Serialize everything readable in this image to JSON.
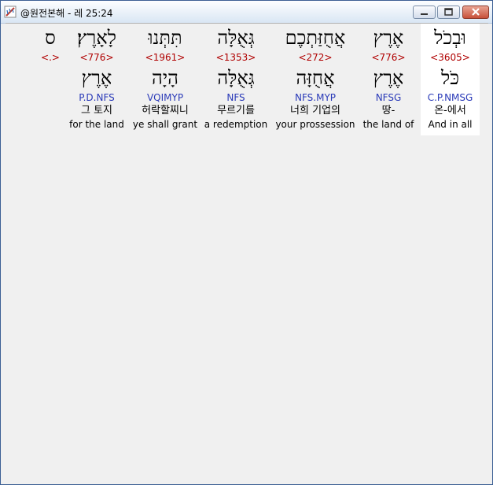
{
  "window": {
    "title": "@원전본해 - 레 25:24",
    "icons": {
      "app": "app-feather-icon",
      "minimize": "minimize-icon",
      "maximize": "maximize-icon",
      "close": "close-icon"
    }
  },
  "words": [
    {
      "heb": "וּבְכֹל",
      "strong": "<3605>",
      "lemma": "כֹּל",
      "parse": "C.P.NMSG",
      "kor": "온-에서",
      "eng": "And in all",
      "selected": true
    },
    {
      "heb": "אֶרֶץ",
      "strong": "<776>",
      "lemma": "אֶרֶץ",
      "parse": "NFSG",
      "kor": "땅-",
      "eng": "the land of",
      "selected": false
    },
    {
      "heb": "אֲחֻזַּתְכֶם",
      "strong": "<272>",
      "lemma": "אֲחֻזָּה",
      "parse": "NFS.MYP",
      "kor": "너희 기업의",
      "eng": "your prossession",
      "selected": false
    },
    {
      "heb": "גְּאֻלָּה",
      "strong": "<1353>",
      "lemma": "גְּאֻלָּה",
      "parse": "NFS",
      "kor": "무르기를",
      "eng": "a redemption",
      "selected": false
    },
    {
      "heb": "תִּתְּנוּ",
      "strong": "<1961>",
      "lemma": "הָיָה",
      "parse": "VQIMYP",
      "kor": "허락할찌니",
      "eng": "ye shall grant",
      "selected": false
    },
    {
      "heb": "לָאָרֶץ׃",
      "strong": "<776>",
      "lemma": "אֶרֶץ",
      "parse": "P.D.NFS",
      "kor": "그 토지",
      "eng": "for the land",
      "selected": false
    },
    {
      "heb": "ס",
      "strong": "<.>",
      "lemma": "",
      "parse": "",
      "kor": "",
      "eng": "",
      "selected": false
    }
  ]
}
